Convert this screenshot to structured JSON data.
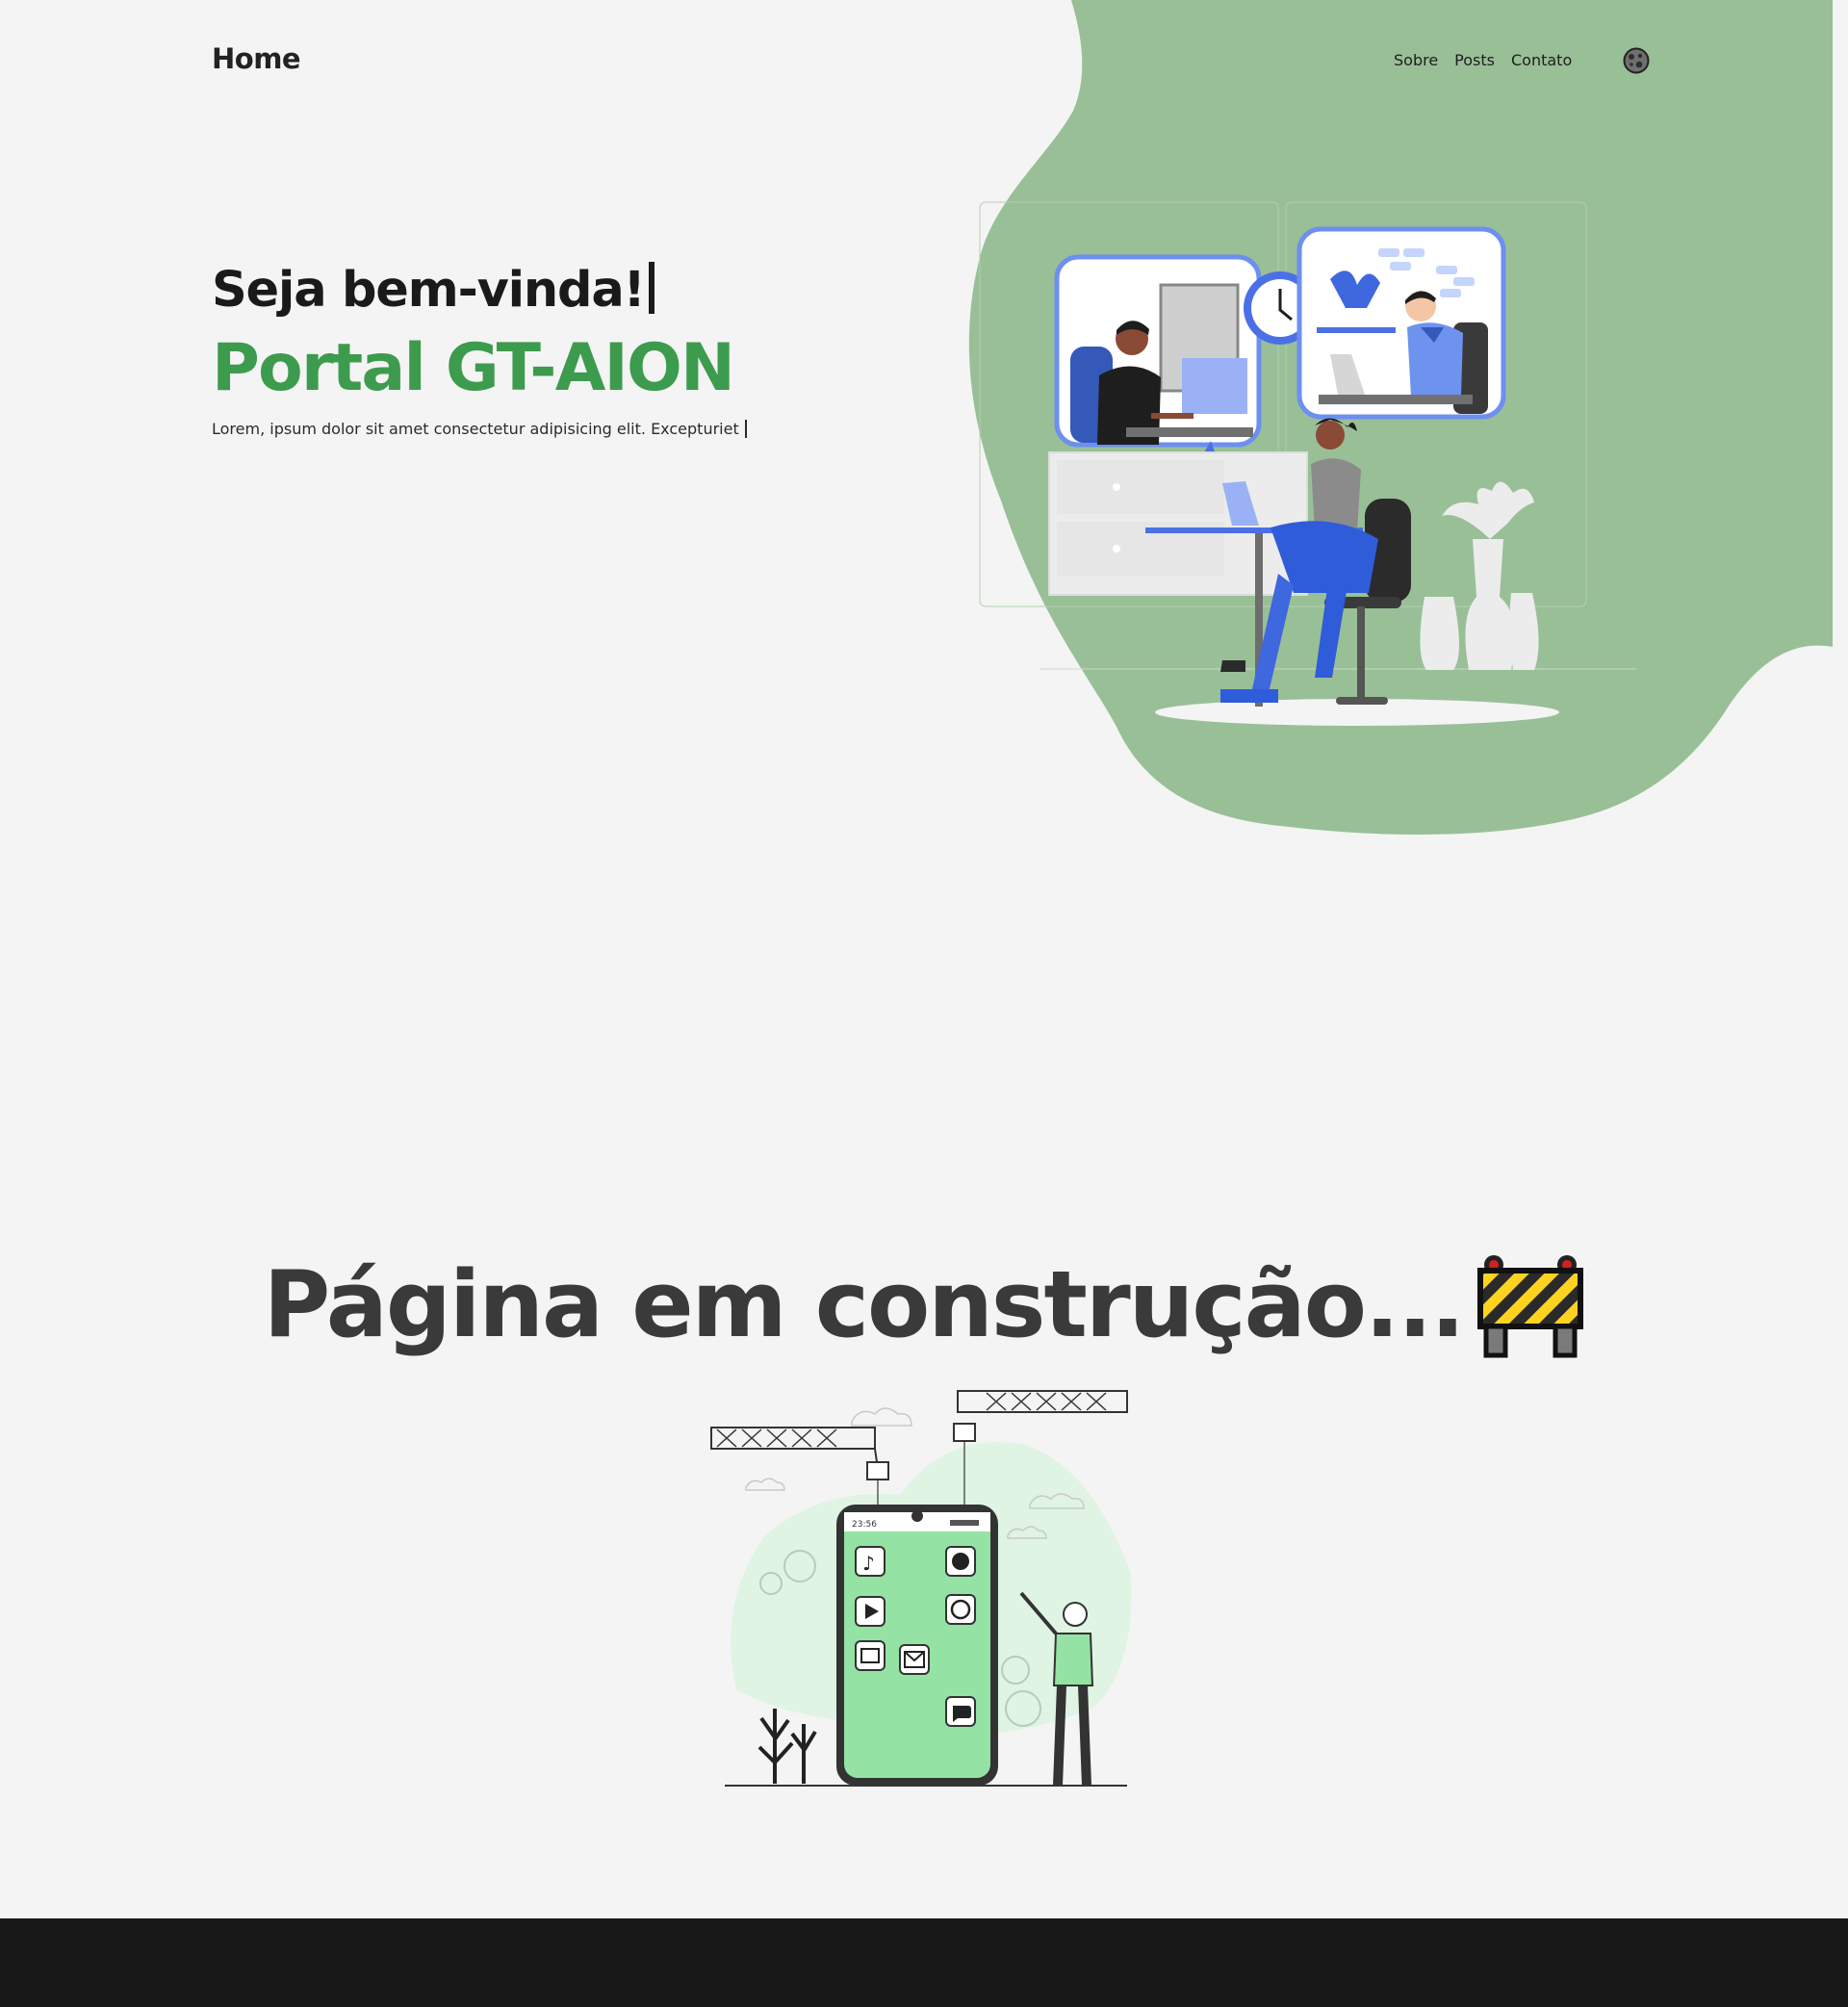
{
  "colors": {
    "background": "#f4f4f4",
    "blob_green": "#99bf97",
    "accent_green": "#3d9b4d",
    "footer": "#181818",
    "phone_green": "#94e2a4"
  },
  "nav": {
    "brand": "Home",
    "links": [
      "Sobre",
      "Posts",
      "Contato"
    ],
    "theme_icon": "globe-icon"
  },
  "hero": {
    "greeting": "Seja bem-vinda!",
    "name": "Portal GT-AION",
    "subtitle": "Lorem, ipsum dolor sit amet consectetur adipisicing elit. Excepturiet"
  },
  "illustrations": {
    "office": "remote-work-illustration",
    "phone_time": "23:56"
  },
  "construction": {
    "title": "Página em construção...",
    "emoji_icon": "construction-barrier-icon"
  }
}
